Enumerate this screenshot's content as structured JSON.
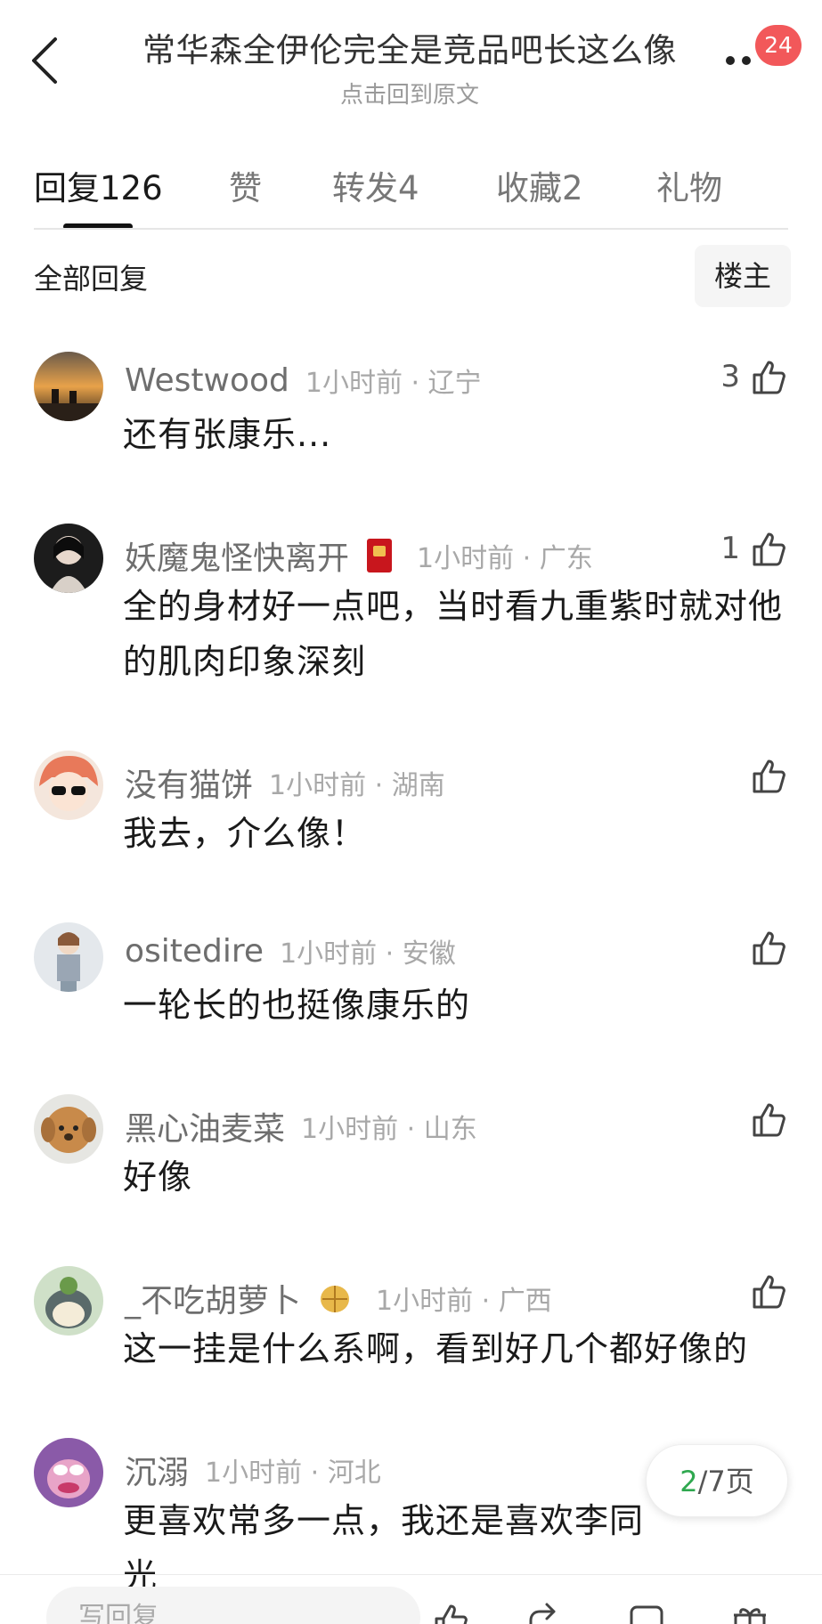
{
  "header": {
    "title": "常华森全伊伦完全是竞品吧长这么像",
    "subtitle": "点击回到原文",
    "notification_count": "24"
  },
  "tabs": [
    {
      "label": "回复",
      "count": "126"
    },
    {
      "label": "赞",
      "count": ""
    },
    {
      "label": "转发",
      "count": "4"
    },
    {
      "label": "收藏",
      "count": "2"
    },
    {
      "label": "礼物",
      "count": ""
    }
  ],
  "filter": {
    "label": "全部回复",
    "owner_button": "楼主"
  },
  "comments": [
    {
      "username": "Westwood",
      "time": "1小时前 · 辽宁",
      "text": "还有张康乐...",
      "likes": "3"
    },
    {
      "username": "妖魔鬼怪快离开",
      "time": "1小时前 · 广东",
      "text": "全的身材好一点吧，当时看九重紫时就对他的肌肉印象深刻",
      "likes": "1"
    },
    {
      "username": "没有猫饼",
      "time": "1小时前 · 湖南",
      "text": "我去，介么像！",
      "likes": ""
    },
    {
      "username": "ositedire",
      "time": "1小时前 · 安徽",
      "text": "一轮长的也挺像康乐的",
      "likes": ""
    },
    {
      "username": "黑心油麦菜",
      "time": "1小时前 · 山东",
      "text": "好像",
      "likes": ""
    },
    {
      "username": "_不吃胡萝卜",
      "time": "1小时前 · 广西",
      "text": "这一挂是什么系啊，看到好几个都好像的",
      "likes": ""
    },
    {
      "username": "沉溺",
      "time": "1小时前 · 河北",
      "text": "更喜欢常多一点，我还是喜欢李同光",
      "likes": ""
    }
  ],
  "pagination": {
    "current": "2",
    "total_text": "/7页"
  },
  "bottom_bar": {
    "reply_placeholder": "写回复"
  },
  "colors": {
    "badge": "#f2585a",
    "page_current": "#2fa84f",
    "tab_indicator": "#111111"
  }
}
